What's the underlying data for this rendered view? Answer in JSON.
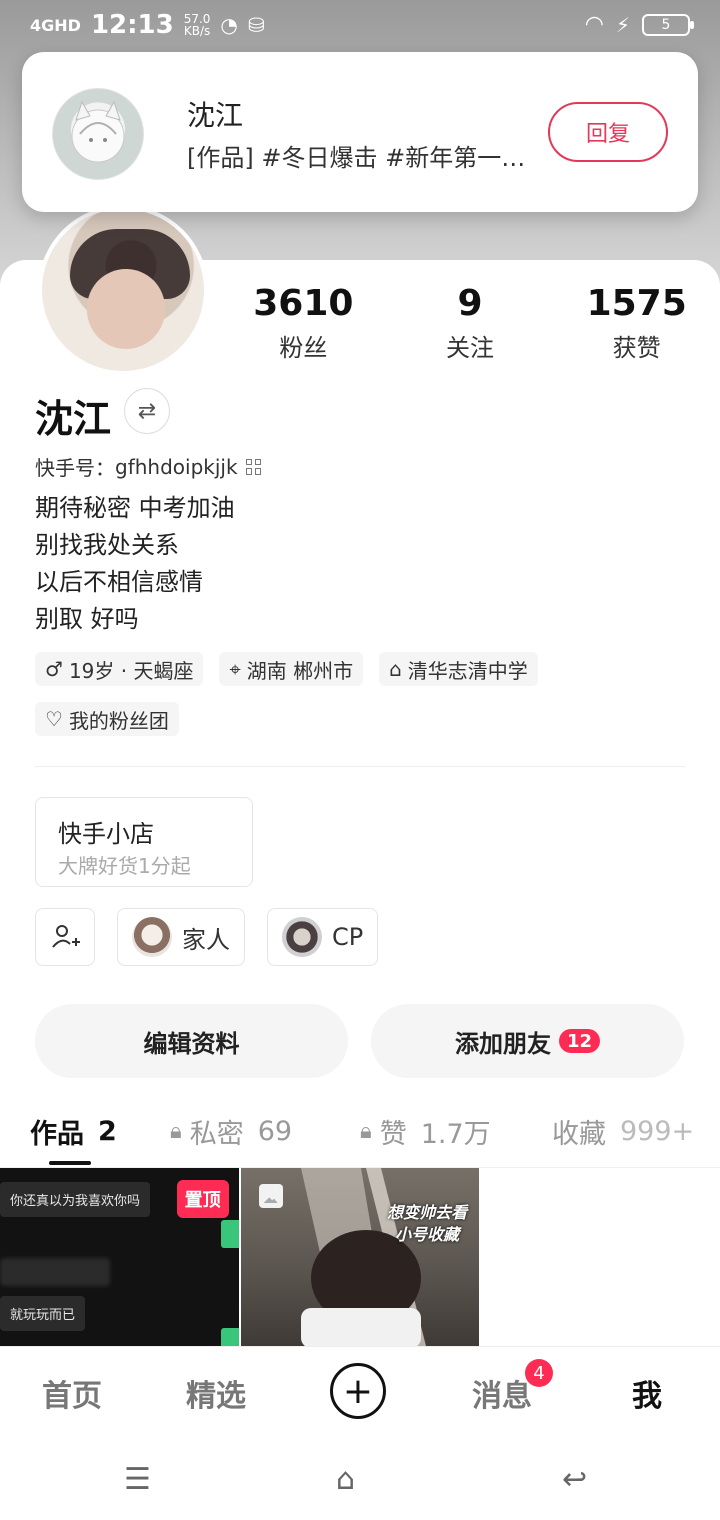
{
  "status": {
    "network": "4GHD",
    "time": "12:13",
    "speed_value": "57.0",
    "speed_unit": "KB/s",
    "battery": "5"
  },
  "notification": {
    "name": "沈江",
    "message": "[作品] #冬日爆击 #新年第一…",
    "reply_label": "回复"
  },
  "profile": {
    "stats": [
      {
        "num": "3610",
        "label": "粉丝"
      },
      {
        "num": "9",
        "label": "关注"
      },
      {
        "num": "1575",
        "label": "获赞"
      }
    ],
    "name": "沈江",
    "kuaishou_id_label": "快手号：",
    "kuaishou_id": "gfhhdoipkjjk",
    "bio_lines": [
      "期待秘密  中考加油",
      "别找我处关系",
      "以后不相信感情",
      "别取 好吗"
    ],
    "tags": [
      {
        "icon": "male-icon",
        "text": "19岁 · 天蝎座"
      },
      {
        "icon": "location-icon",
        "text": "湖南 郴州市"
      },
      {
        "icon": "graduation-cap-icon",
        "text": "清华志清中学"
      },
      {
        "icon": "heart-outline-icon",
        "text": "我的粉丝团"
      }
    ],
    "shop_title": "快手小店",
    "shop_subtitle": "大牌好货1分起",
    "chips": [
      {
        "label": "家人"
      },
      {
        "label": "CP"
      }
    ],
    "edit_label": "编辑资料",
    "add_friend_label": "添加朋友",
    "add_friend_count": "12"
  },
  "tabs": [
    {
      "label": "作品",
      "count": "2"
    },
    {
      "label": "私密",
      "count": "69"
    },
    {
      "label": "赞",
      "count": "1.7万"
    },
    {
      "label": "收藏",
      "count": "999+"
    }
  ],
  "grid": {
    "tile1": {
      "bubble1": "你还真以为我喜欢你吗",
      "bubble3": "就玩玩而已",
      "pin_label": "置顶"
    },
    "tile2": {
      "caption_line1": "想变帅去看",
      "caption_line2": "小号收藏"
    }
  },
  "bottom_nav": {
    "home": "首页",
    "featured": "精选",
    "messages": "消息",
    "messages_badge": "4",
    "me": "我"
  }
}
